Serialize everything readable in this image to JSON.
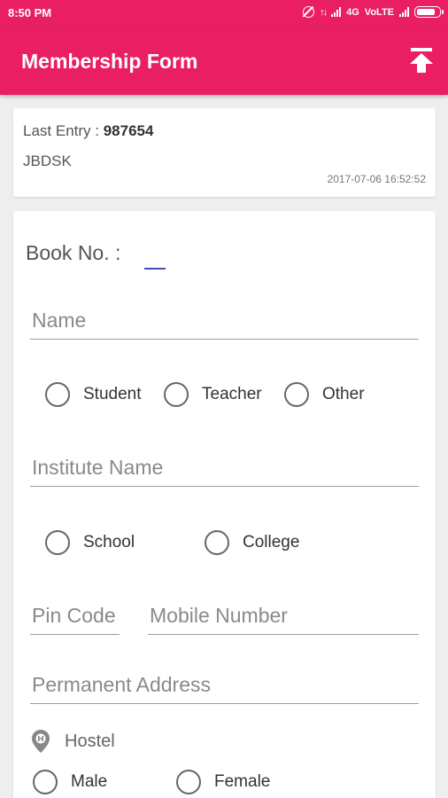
{
  "status_bar": {
    "time": "8:50 PM",
    "network": "4G",
    "volte": "VoLTE"
  },
  "app_bar": {
    "title": "Membership Form",
    "action_icon": "upload-icon",
    "background_color": "#e91e63"
  },
  "last_entry": {
    "label": "Last Entry :",
    "number": "987654",
    "code": "JBDSK",
    "timestamp": "2017-07-06 16:52:52"
  },
  "form": {
    "book_label": "Book No. :",
    "book_value": "",
    "name_placeholder": "Name",
    "occupation_options": [
      "Student",
      "Teacher",
      "Other"
    ],
    "institute_placeholder": "Institute Name",
    "institution_options": [
      "School",
      "College"
    ],
    "pin_placeholder": "Pin Code",
    "mobile_placeholder": "Mobile Number",
    "address_placeholder": "Permanent Address",
    "hostel_icon": "location-pin-icon",
    "hostel_label": "Hostel",
    "gender_options": [
      "Male",
      "Female"
    ]
  }
}
